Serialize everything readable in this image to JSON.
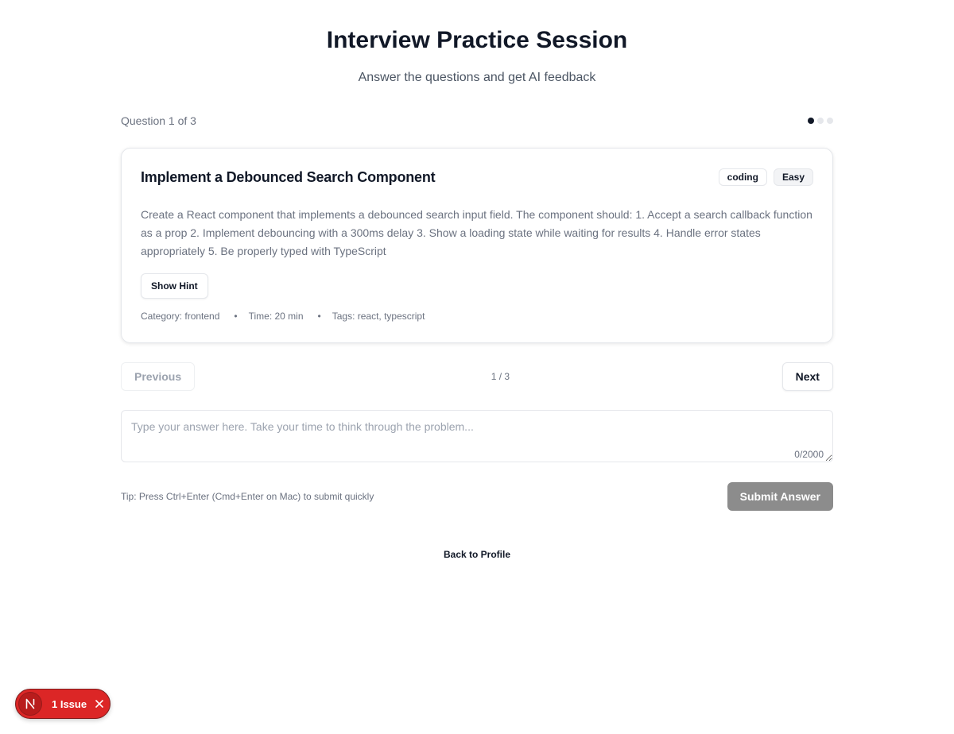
{
  "header": {
    "title": "Interview Practice Session",
    "subtitle": "Answer the questions and get AI feedback"
  },
  "progress": {
    "label": "Question 1 of 3",
    "current": 1,
    "total": 3
  },
  "question": {
    "title": "Implement a Debounced Search Component",
    "badges": [
      "coding",
      "Easy"
    ],
    "description": "Create a React component that implements a debounced search input field. The component should: 1. Accept a search callback function as a prop 2. Implement debouncing with a 300ms delay 3. Show a loading state while waiting for results 4. Handle error states appropriately 5. Be properly typed with TypeScript",
    "hint_label": "Show Hint",
    "meta": {
      "category": "Category: frontend",
      "time": "Time: 20 min",
      "tags": "Tags: react, typescript",
      "separator": "•"
    }
  },
  "navigation": {
    "previous_label": "Previous",
    "next_label": "Next",
    "page_indicator": "1 / 3"
  },
  "answer": {
    "placeholder": "Type your answer here. Take your time to think through the problem...",
    "value": "",
    "char_count": "0/2000"
  },
  "submit": {
    "tip": "Tip: Press Ctrl+Enter (Cmd+Enter on Mac) to submit quickly",
    "label": "Submit Answer"
  },
  "footer": {
    "back_label": "Back to Profile"
  },
  "dev_overlay": {
    "logo_icon": "nextjs-icon",
    "issue_label": "1 Issue",
    "close_icon": "close-icon"
  },
  "colors": {
    "active_dot": "#111827",
    "submit_disabled": "#8c8c8c",
    "issue_badge": "#dc2626"
  }
}
